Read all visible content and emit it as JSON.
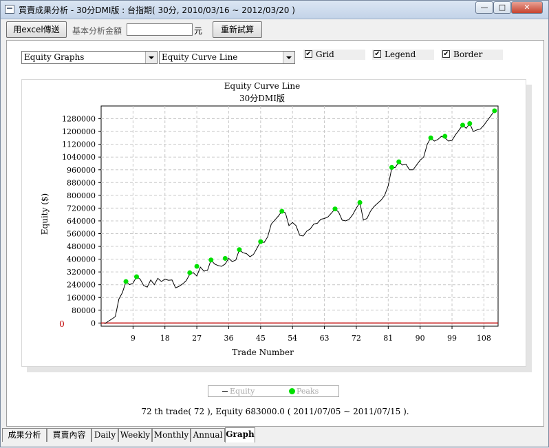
{
  "window": {
    "title": "買賣成果分析 - 30分DMI版 : 台指期( 30分, 2010/03/16 ~ 2012/03/20 )",
    "min_glyph": "—",
    "max_glyph": "□",
    "close_glyph": "✕"
  },
  "toolbar": {
    "excel_button": "用excel傳送",
    "base_amount_label": "基本分析金額",
    "base_amount_value": "",
    "currency_unit": "元",
    "recalc_button": "重新試算"
  },
  "controls": {
    "graph_type": "Equity Graphs",
    "graph_style": "Equity Curve Line",
    "grid": {
      "label": "Grid",
      "checked": true
    },
    "legend": {
      "label": "Legend",
      "checked": true
    },
    "border": {
      "label": "Border",
      "checked": true
    }
  },
  "colors": {
    "line": "#000000",
    "peak": "#00e000",
    "zero_line": "#c00000",
    "grid": "#c8c8c8"
  },
  "chart_data": {
    "type": "line",
    "title": "Equity Curve Line",
    "subtitle": "30分DMI版",
    "xlabel": "Trade Number",
    "ylabel": "Equity ($)",
    "xlim": [
      0,
      112
    ],
    "ylim": [
      -20000,
      1360000
    ],
    "x_ticks": [
      9,
      18,
      27,
      36,
      45,
      54,
      63,
      72,
      81,
      90,
      99,
      108
    ],
    "y_ticks": [
      0,
      80000,
      160000,
      240000,
      320000,
      400000,
      480000,
      560000,
      640000,
      720000,
      800000,
      880000,
      960000,
      1040000,
      1120000,
      1200000,
      1280000
    ],
    "zero_label": "0",
    "grid": true,
    "legend_position": "bottom-center",
    "series": [
      {
        "name": "Equity",
        "x": [
          1,
          2,
          3,
          4,
          5,
          6,
          7,
          8,
          9,
          10,
          11,
          12,
          13,
          14,
          15,
          16,
          17,
          18,
          19,
          20,
          21,
          22,
          23,
          24,
          25,
          26,
          27,
          28,
          29,
          30,
          31,
          32,
          33,
          34,
          35,
          36,
          37,
          38,
          39,
          40,
          41,
          42,
          43,
          44,
          45,
          46,
          47,
          48,
          49,
          50,
          51,
          52,
          53,
          54,
          55,
          56,
          57,
          58,
          59,
          60,
          61,
          62,
          63,
          64,
          65,
          66,
          67,
          68,
          69,
          70,
          71,
          72,
          73,
          74,
          75,
          76,
          77,
          78,
          79,
          80,
          81,
          82,
          83,
          84,
          85,
          86,
          87,
          88,
          89,
          90,
          91,
          92,
          93,
          94,
          95,
          96,
          97,
          98,
          99,
          100,
          101,
          102,
          103,
          104,
          105,
          106,
          107,
          108,
          109,
          110,
          111
        ],
        "y": [
          -5000,
          10000,
          25000,
          40000,
          150000,
          190000,
          260000,
          240000,
          250000,
          290000,
          275000,
          235000,
          225000,
          270000,
          240000,
          280000,
          260000,
          275000,
          268000,
          270000,
          220000,
          230000,
          245000,
          265000,
          305000,
          315000,
          295000,
          350000,
          325000,
          330000,
          395000,
          370000,
          360000,
          355000,
          370000,
          405000,
          385000,
          395000,
          460000,
          440000,
          435000,
          415000,
          430000,
          470000,
          510000,
          505000,
          540000,
          620000,
          645000,
          670000,
          700000,
          690000,
          610000,
          630000,
          610000,
          550000,
          545000,
          575000,
          590000,
          620000,
          625000,
          650000,
          655000,
          665000,
          690000,
          715000,
          695000,
          645000,
          640000,
          650000,
          680000,
          720000,
          755000,
          645000,
          655000,
          700000,
          730000,
          750000,
          770000,
          800000,
          860000,
          970000,
          975000,
          1010000,
          990000,
          995000,
          960000,
          960000,
          990000,
          1020000,
          1040000,
          1120000,
          1160000,
          1140000,
          1150000,
          1170000,
          1160000,
          1140000,
          1145000,
          1180000,
          1210000,
          1240000,
          1220000,
          1250000,
          1200000,
          1210000,
          1215000,
          1240000,
          1270000,
          1300000,
          1330000
        ]
      },
      {
        "name": "Peaks",
        "x": [
          7,
          10,
          25,
          27,
          31,
          35,
          39,
          45,
          51,
          66,
          73,
          82,
          84,
          93,
          97,
          102,
          104,
          111
        ],
        "y": [
          260000,
          290000,
          315000,
          355000,
          395000,
          405000,
          460000,
          510000,
          700000,
          715000,
          755000,
          975000,
          1010000,
          1160000,
          1170000,
          1240000,
          1250000,
          1330000
        ]
      }
    ]
  },
  "legend": {
    "equity_label": "Equity",
    "peaks_label": "Peaks"
  },
  "status": {
    "text": "72 th trade( 72 ), Equity  683000.0 ( 2011/07/05 ~ 2011/07/15 )."
  },
  "tabs": [
    "成果分析",
    "買賣內容",
    "Daily",
    "Weekly",
    "Monthly",
    "Annual",
    "Graph"
  ]
}
